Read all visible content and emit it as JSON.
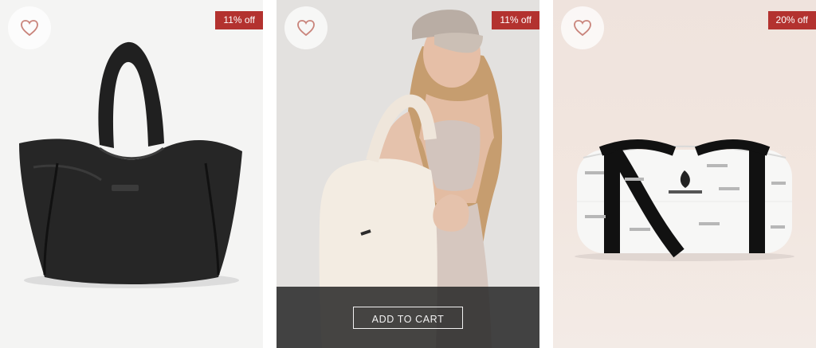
{
  "products": [
    {
      "discount": "11% off",
      "wishlist_icon": "heart-outline-icon"
    },
    {
      "discount": "11% off",
      "wishlist_icon": "heart-outline-icon",
      "cart_label": "ADD TO CART"
    },
    {
      "discount": "20% off",
      "wishlist_icon": "heart-outline-icon"
    }
  ],
  "colors": {
    "badge": "#b3322f",
    "heart": "#c9847b",
    "overlay": "#282828"
  }
}
